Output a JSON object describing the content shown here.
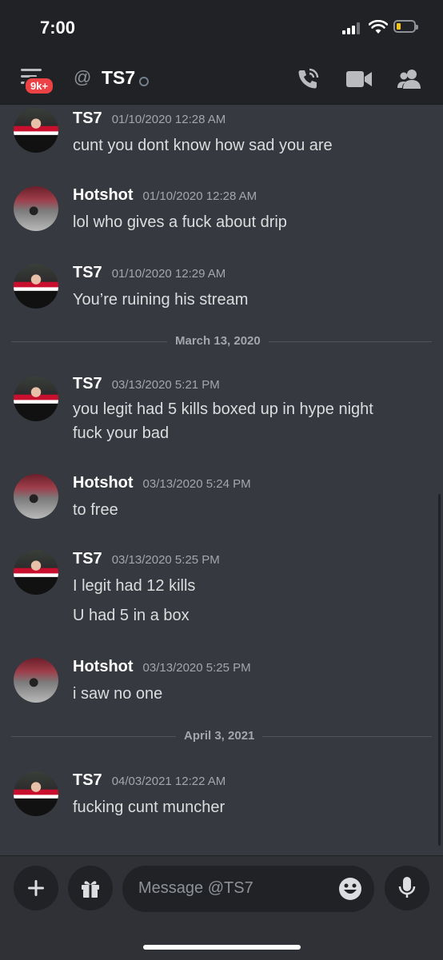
{
  "status": {
    "time": "7:00"
  },
  "header": {
    "badge": "9k+",
    "at_symbol": "@",
    "title": "TS7"
  },
  "messages": [
    {
      "author": "TS7",
      "timestamp": "01/10/2020 12:28 AM",
      "lines": [
        "cunt you dont know how sad you are"
      ]
    },
    {
      "author": "Hotshot",
      "timestamp": "01/10/2020 12:28 AM",
      "lines": [
        "lol who gives a fuck about drip"
      ]
    },
    {
      "author": "TS7",
      "timestamp": "01/10/2020 12:29 AM",
      "lines": [
        "You’re ruining his stream"
      ]
    },
    {
      "author": "TS7",
      "timestamp": "03/13/2020 5:21 PM",
      "lines": [
        "you legit had 5 kills boxed up in hype night",
        "fuck your bad"
      ]
    },
    {
      "author": "Hotshot",
      "timestamp": "03/13/2020 5:24 PM",
      "lines": [
        "to free"
      ]
    },
    {
      "author": "TS7",
      "timestamp": "03/13/2020 5:25 PM",
      "lines": [
        "I legit had 12 kills",
        "U had 5 in a box"
      ]
    },
    {
      "author": "Hotshot",
      "timestamp": "03/13/2020 5:25 PM",
      "lines": [
        "i saw no one"
      ]
    },
    {
      "author": "TS7",
      "timestamp": "04/03/2021 12:22 AM",
      "lines": [
        "fucking cunt muncher"
      ]
    }
  ],
  "dividers": [
    "March 13, 2020",
    "April 3, 2021"
  ],
  "composer": {
    "placeholder": "Message @TS7"
  },
  "icons": {
    "menu": "hamburger-icon",
    "call": "phone-call-icon",
    "video": "video-camera-icon",
    "members": "members-icon",
    "add": "plus-icon",
    "gift": "gift-icon",
    "emoji": "emoji-icon",
    "mic": "microphone-icon"
  },
  "colors": {
    "background": "#36393f",
    "header": "#202225",
    "badge": "#ed4245",
    "text": "#dcddde",
    "muted": "#a3a6aa"
  }
}
